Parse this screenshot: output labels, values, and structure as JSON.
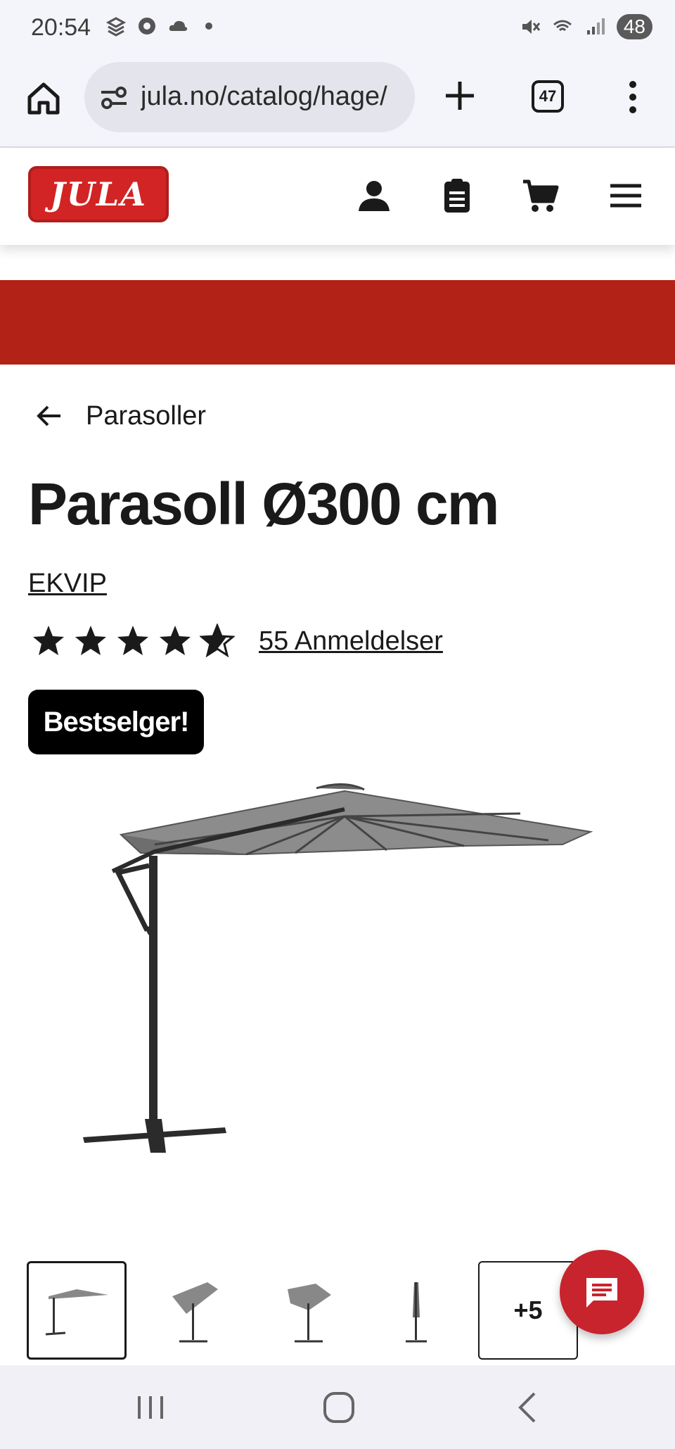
{
  "status_bar": {
    "time": "20:54",
    "battery": "48"
  },
  "browser": {
    "url": "jula.no/catalog/hage/",
    "tab_count": "47"
  },
  "site": {
    "logo_text": "JULA",
    "brand_color": "#b22216"
  },
  "breadcrumb": {
    "label": "Parasoller"
  },
  "product": {
    "title": "Parasoll Ø300 cm",
    "brand": "EKVIP",
    "rating": 4.5,
    "rating_max": 5,
    "reviews_label": "55 Anmeldelser",
    "badge": "Bestselger!"
  },
  "gallery": {
    "selected_index": 0,
    "more_label": "+5"
  },
  "colors": {
    "accent_red": "#b22216",
    "chat_red": "#c8242d",
    "badge_bg": "#000000"
  }
}
